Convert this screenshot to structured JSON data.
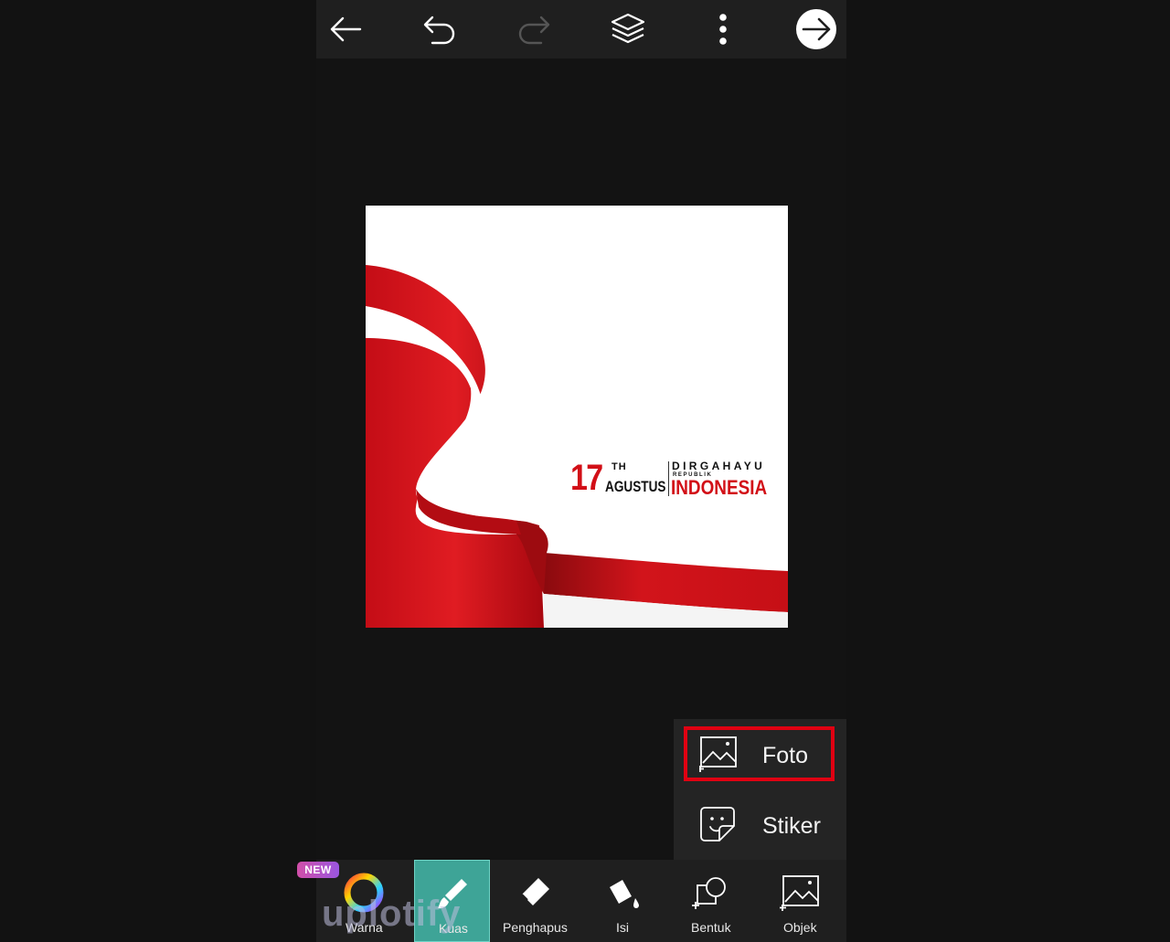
{
  "topbar": {
    "back_icon": "arrow-left-icon",
    "undo_icon": "undo-icon",
    "redo_icon": "redo-icon",
    "layers_icon": "layers-icon",
    "more_icon": "more-vertical-icon",
    "next_icon": "arrow-right-circle-icon"
  },
  "canvas": {
    "num": "17",
    "th": "TH",
    "month": "AGUSTUS",
    "dirgahayu": "DIRGAHAYU",
    "republik": "REPUBLIK",
    "indonesia": "INDONESIA"
  },
  "popup": {
    "items": [
      {
        "label": "Foto",
        "icon": "add-image-icon"
      },
      {
        "label": "Stiker",
        "icon": "sticker-icon"
      }
    ]
  },
  "toolbar": {
    "items": [
      {
        "label": "Warna",
        "icon": "color-wheel-icon"
      },
      {
        "label": "Kuas",
        "icon": "brush-icon"
      },
      {
        "label": "Penghapus",
        "icon": "eraser-icon"
      },
      {
        "label": "Isi",
        "icon": "fill-bucket-icon"
      },
      {
        "label": "Bentuk",
        "icon": "shape-icon"
      },
      {
        "label": "Objek",
        "icon": "object-image-icon"
      }
    ],
    "new_badge": "NEW"
  },
  "watermark": "uplotify",
  "colors": {
    "accent": "#3ea497",
    "flag_red": "#d20f17",
    "highlight": "#e00012"
  }
}
